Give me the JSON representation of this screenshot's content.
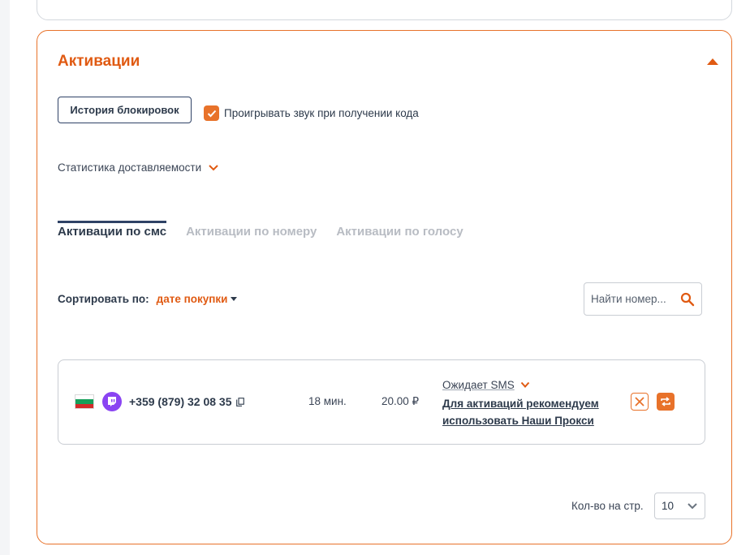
{
  "colors": {
    "accent": "#e8722a",
    "title": "#e05a12",
    "navy": "#2f4266",
    "text": "#2d3a4b",
    "muted_tab": "#b8bcc3"
  },
  "activations": {
    "title": "Активации",
    "history_button": "История блокировок",
    "sound_checkbox": {
      "label": "Проигрывать звук при получении кода",
      "checked": true
    },
    "stats_label": "Статистика доставляемости",
    "tabs": [
      {
        "label": "Активации по смс",
        "active": true
      },
      {
        "label": "Активации по номеру",
        "active": false
      },
      {
        "label": "Активации по голосу",
        "active": false
      }
    ],
    "sort": {
      "label": "Сортировать по:",
      "value": "дате покупки"
    },
    "search": {
      "placeholder": "Найти номер...",
      "value": ""
    },
    "rows": [
      {
        "flag": "bulgaria-flag",
        "service_icon": "twitch-icon",
        "phone": "+359 (879) 32 08 35",
        "time": "18 мин.",
        "price": "20.00 ₽",
        "status": "Ожидает SMS",
        "proxy_link": "Для активаций рекомендуем использовать Наши Прокси"
      }
    ],
    "per_page": {
      "label": "Кол-во на стр.",
      "value": "10"
    }
  }
}
